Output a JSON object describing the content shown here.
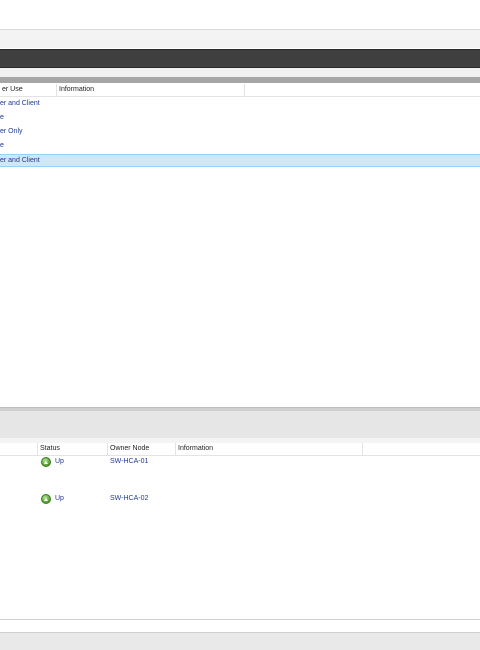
{
  "upper_table": {
    "columns": [
      {
        "label": "er Use"
      },
      {
        "label": "Information"
      }
    ],
    "rows": [
      {
        "use": "er and Client",
        "selected": false
      },
      {
        "use": "e",
        "selected": false
      },
      {
        "use": "er Only",
        "selected": false
      },
      {
        "use": "e",
        "selected": false
      },
      {
        "use": "er and Client",
        "selected": true
      }
    ]
  },
  "lower_table": {
    "columns": [
      {
        "label": ""
      },
      {
        "label": "Status"
      },
      {
        "label": "Owner Node"
      },
      {
        "label": "Information"
      }
    ],
    "rows": [
      {
        "status": "Up",
        "status_icon": "status-up-icon",
        "owner_node": "SW-HCA-01"
      },
      {
        "status": "Up",
        "status_icon": "status-up-icon",
        "owner_node": "SW-HCA-02"
      }
    ]
  },
  "colors": {
    "selection": "#cde8f8",
    "link_text": "#1f3a93",
    "header_dark": "#3f3f3f"
  }
}
